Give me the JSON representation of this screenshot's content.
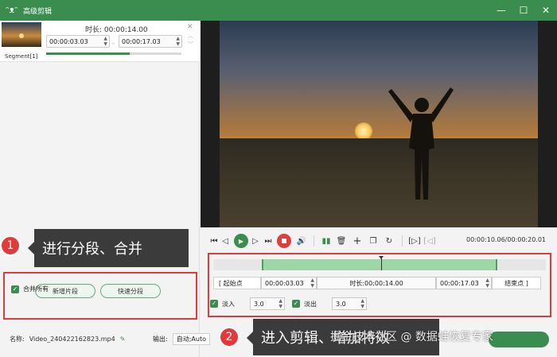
{
  "window": {
    "title": "高级剪辑",
    "icon": "frog-icon",
    "controls": [
      "—",
      "☐",
      "✕"
    ]
  },
  "segment": {
    "duration_label": "时长:",
    "duration": "00:00:14.00",
    "start": "00:00:03.03",
    "end": "00:00:17.03",
    "separator": "-",
    "name": "Segment[1]",
    "progress": 0.62
  },
  "left_buttons": {
    "new_segment": "新增片段",
    "quick_split": "快速分段",
    "merge_all": "合并所有"
  },
  "callouts": {
    "one": {
      "num": "1",
      "text": "进行分段、合并"
    },
    "two": {
      "num": "2",
      "text": "进入剪辑、增加特效"
    }
  },
  "player": {
    "time_readout": "00:00:10.06/00:00:20.01"
  },
  "clip": {
    "start_btn": "[ 起始点",
    "start_value": "00:00:03.03",
    "duration_label": "时长:",
    "duration_value": "00:00:14.00",
    "end_value": "00:00:17.03",
    "end_btn": "结束点 ]",
    "fade_in_label": "淡入",
    "fade_in_value": "3.0",
    "fade_out_label": "淡出",
    "fade_out_value": "3.0"
  },
  "footer": {
    "name_label": "名称:",
    "file_name": "Video_240422162823.mp4",
    "output_label": "输出:",
    "output_value": "自动;Auto"
  },
  "watermark": "掘金技术社区 @ 数据蛙恢复专家",
  "colors": {
    "accent": "#3a8d4f",
    "callout_red": "#e03c3c"
  }
}
